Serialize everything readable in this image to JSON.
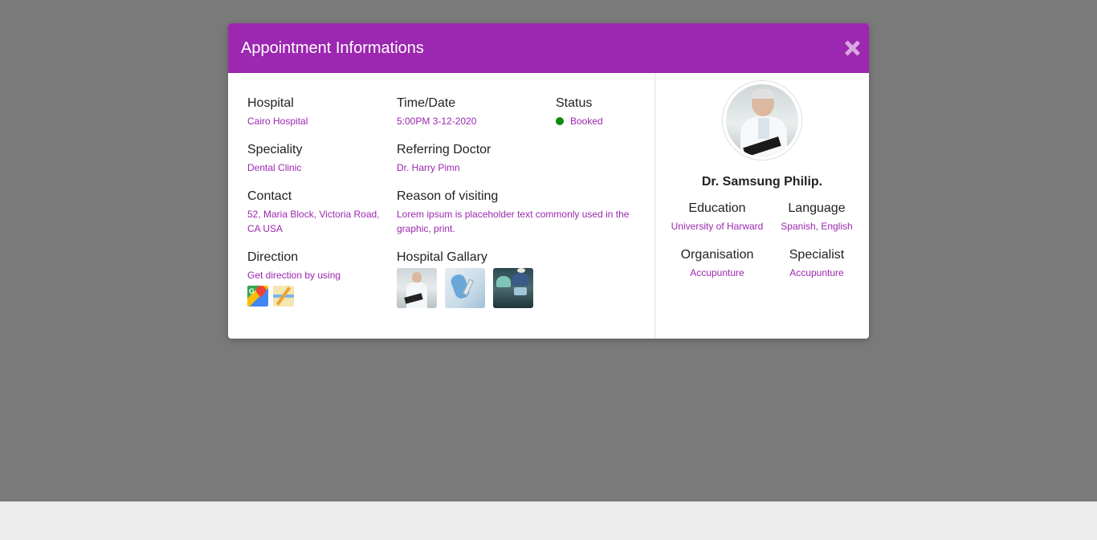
{
  "modal": {
    "title": "Appointment Informations",
    "close_icon": "close-icon"
  },
  "appointment": {
    "hospital_label": "Hospital",
    "hospital_value": "Cairo Hospital",
    "time_label": "Time/Date",
    "time_value": "5:00PM 3-12-2020",
    "status_label": "Status",
    "status_value": "Booked",
    "speciality_label": "Speciality",
    "speciality_value": "Dental Clinic",
    "referring_label": "Referring Doctor",
    "referring_value": "Dr. Harry Pimn",
    "contact_label": "Contact",
    "contact_value": "52, Maria Block, Victoria Road, CA USA",
    "reason_label": "Reason of visiting",
    "reason_value": "Lorem ipsum is placeholder text commonly used in the graphic, print.",
    "direction_label": "Direction",
    "direction_value": "Get direction by using",
    "gallery_label": "Hospital Gallary"
  },
  "doctor": {
    "name": "Dr. Samsung Philip.",
    "education_label": "Education",
    "education_value": "University of Harward",
    "language_label": "Language",
    "language_value": "Spanish, English",
    "organisation_label": "Organisation",
    "organisation_value": "Accupunture",
    "specialist_label": "Specialist",
    "specialist_value": "Accupunture"
  },
  "colors": {
    "accent": "#9c27b0",
    "status": "#0a8a0a",
    "backdrop": "#7a7a7a"
  }
}
